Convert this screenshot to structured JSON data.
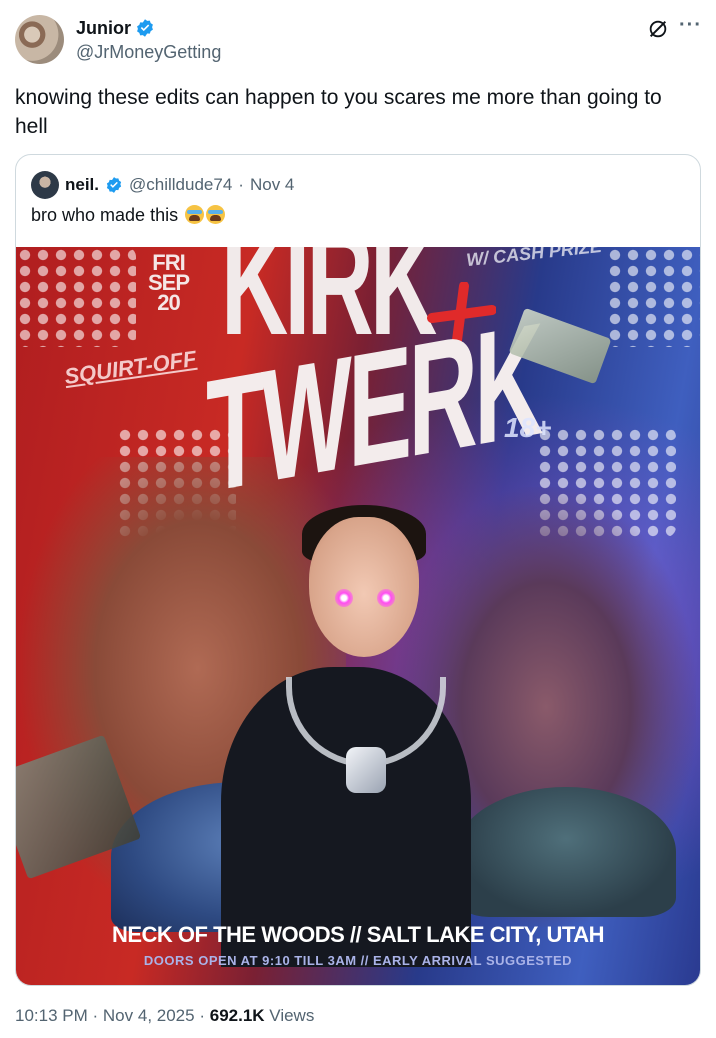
{
  "author": {
    "name": "Junior",
    "handle": "@JrMoneyGetting",
    "verified": true
  },
  "header_icons": {
    "grok": "grok-icon",
    "more": "···"
  },
  "tweet": {
    "text": "knowing these edits can happen to you scares me more than going to hell"
  },
  "quote": {
    "name": "neil.",
    "handle": "@chilldude74",
    "separator": "·",
    "date": "Nov 4",
    "text": "bro who made this",
    "emojis": [
      "loudly-crying-face",
      "loudly-crying-face"
    ],
    "poster": {
      "date_day": "FRI",
      "date_month": "SEP",
      "date_num": "20",
      "squirt": "SQUIRT-OFF",
      "prize": "W/ CASH PRIZE",
      "title_top": "KIRK",
      "title_bottom": "TWERK",
      "age": "18+",
      "venue": "NECK OF THE WOODS // SALT LAKE CITY, UTAH",
      "doors": "DOORS OPEN AT 9:10 TILL 3AM // EARLY ARRIVAL SUGGESTED"
    }
  },
  "footer": {
    "time": "10:13 PM",
    "sep1": "·",
    "date": "Nov 4, 2025",
    "sep2": "·",
    "views_count": "692.1K",
    "views_label": "Views"
  },
  "colors": {
    "verified_blue": "#1d9bf0",
    "text_primary": "#0f1419",
    "text_secondary": "#536471",
    "border": "#cfd9de"
  }
}
